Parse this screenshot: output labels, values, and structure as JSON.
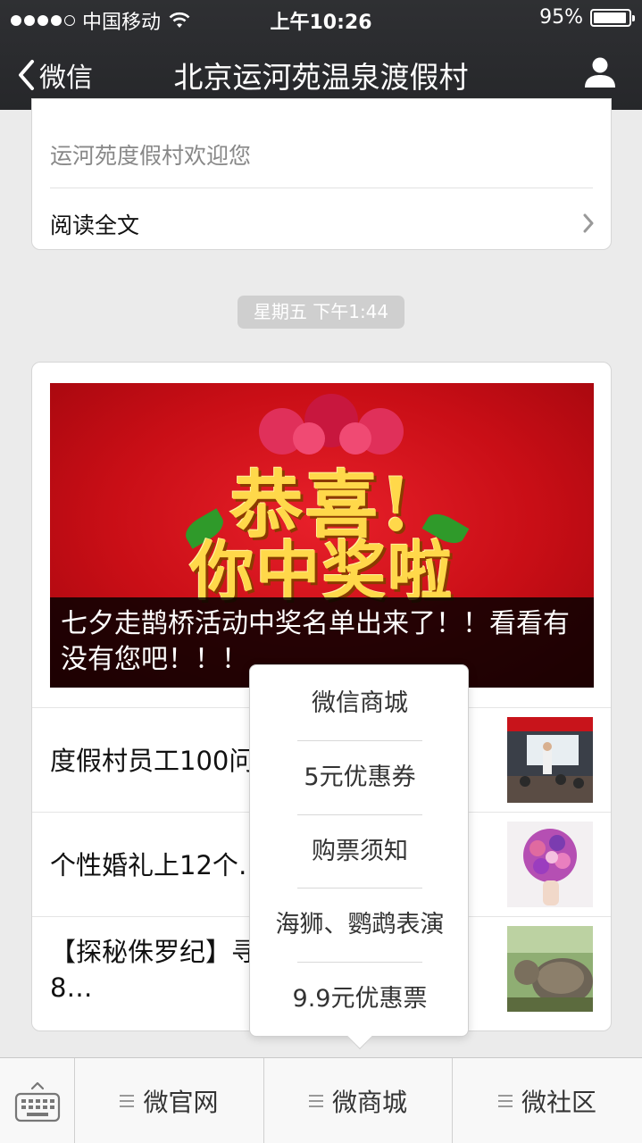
{
  "status_bar": {
    "carrier": "中国移动",
    "time": "上午10:26",
    "battery": "95%",
    "battery_level": 0.95,
    "signal_icon": "signal-dots-icon",
    "wifi_icon": "wifi-icon"
  },
  "nav": {
    "back_label": "微信",
    "title": "北京运河苑温泉渡假村",
    "profile_icon": "person-icon"
  },
  "card1": {
    "description": "运河苑度假村欢迎您",
    "read_all": "阅读全文"
  },
  "timestamp": "星期五 下午1:44",
  "news": {
    "banner_art_line1": "恭喜!",
    "banner_art_line2": "你中奖啦",
    "headline": "七夕走鹊桥活动中奖名单出来了！！看看有没有您吧！！！",
    "items": [
      {
        "title": "度假村员工100问……事",
        "thumb_icon": "conference-photo"
      },
      {
        "title": "个性婚礼上12个…",
        "thumb_icon": "bouquet-photo"
      },
      {
        "title": "【探秘侏罗纪】寻…大型恐龙科普展8…",
        "thumb_icon": "dinosaur-photo"
      }
    ]
  },
  "popup_menu": {
    "items": [
      "微信商城",
      "5元优惠券",
      "购票须知",
      "海狮、鹦鹉表演",
      "9.9元优惠票"
    ]
  },
  "bottom_menu": {
    "keyboard_icon": "keyboard-icon",
    "tabs": [
      "微官网",
      "微商城",
      "微社区"
    ]
  },
  "colors": {
    "nav_bg": "#2b2c2f",
    "page_bg": "#ebebeb",
    "banner_red": "#d0121a",
    "banner_gold": "#ffd84a"
  }
}
